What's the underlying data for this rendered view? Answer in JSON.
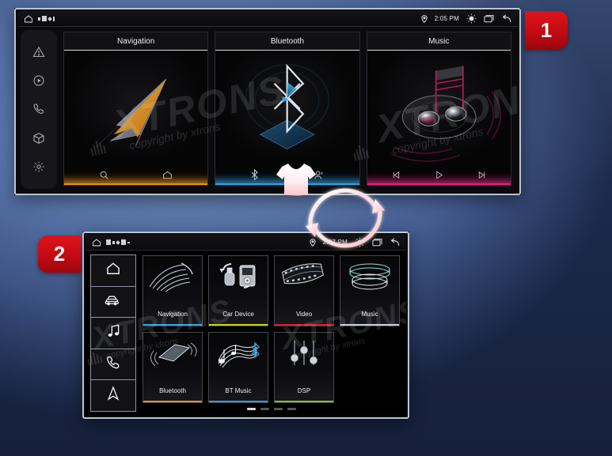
{
  "background": {
    "top_color": "#5b79ad",
    "bottom_color": "#1e2a4a"
  },
  "badges": [
    {
      "name": "step-one",
      "label": "1",
      "color": "#cc0a12"
    },
    {
      "name": "step-two",
      "label": "2",
      "color": "#cc0a12"
    }
  ],
  "swap_graphic": {
    "name": "ui-theme-swap",
    "icon": "tshirt-icon",
    "arrow_icon": "circular-arrows-icon",
    "color": "#f2b6bd"
  },
  "screen1": {
    "statusbar": {
      "home_icon": "home-icon",
      "indicator_icons": [
        "sd-card-icon",
        "battery-icon",
        "bluetooth-dot-icon",
        "gps-icon"
      ],
      "location_icon": "location-pin-icon",
      "time": "2:05 PM",
      "brightness_icon": "brightness-icon",
      "recents_icon": "recents-icon",
      "back_icon": "back-arrow-icon"
    },
    "sidebar": {
      "items": [
        {
          "name": "sidebar-item-adas",
          "icon": "warning-triangle-icon"
        },
        {
          "name": "sidebar-item-media",
          "icon": "play-circle-icon"
        },
        {
          "name": "sidebar-item-phone",
          "icon": "phone-icon"
        },
        {
          "name": "sidebar-item-apps",
          "icon": "cube-icon"
        },
        {
          "name": "sidebar-item-settings",
          "icon": "gear-icon"
        }
      ]
    },
    "cards": [
      {
        "name": "card-navigation",
        "title": "Navigation",
        "accent": "#e8901a",
        "art": "navigation-arrow-art",
        "controls": [
          {
            "name": "nav-search-button",
            "icon": "search-icon"
          },
          {
            "name": "nav-home-button",
            "icon": "home-icon"
          }
        ]
      },
      {
        "name": "card-bluetooth",
        "title": "Bluetooth",
        "accent": "#2f9fe0",
        "art": "bluetooth-logo-art",
        "controls": [
          {
            "name": "bt-toggle-button",
            "icon": "bluetooth-icon"
          },
          {
            "name": "bt-contacts-button",
            "icon": "contacts-icon"
          }
        ]
      },
      {
        "name": "card-music",
        "title": "Music",
        "accent": "#e0247c",
        "art": "music-disc-art",
        "controls": [
          {
            "name": "music-prev-button",
            "icon": "previous-track-icon"
          },
          {
            "name": "music-play-button",
            "icon": "play-icon"
          },
          {
            "name": "music-next-button",
            "icon": "next-track-icon"
          }
        ]
      }
    ]
  },
  "screen2": {
    "statusbar": {
      "home_icon": "home-icon",
      "indicator_icons": [
        "sd-card-icon",
        "sim-icon",
        "bluetooth-dot-icon",
        "battery-icon",
        "gps-icon"
      ],
      "location_icon": "location-pin-icon",
      "time": "2:07 PM",
      "brightness_icon": "brightness-icon",
      "recents_icon": "recents-icon",
      "back_icon": "back-arrow-icon"
    },
    "sidebar": {
      "items": [
        {
          "name": "sidebar-item-home",
          "icon": "home-icon"
        },
        {
          "name": "sidebar-item-car",
          "icon": "car-icon"
        },
        {
          "name": "sidebar-item-music",
          "icon": "music-note-icon"
        },
        {
          "name": "sidebar-item-phone",
          "icon": "phone-icon"
        },
        {
          "name": "sidebar-item-navigation",
          "icon": "navigation-arrow-icon"
        }
      ]
    },
    "tiles_row1": [
      {
        "name": "tile-navigation",
        "label": "Navigation",
        "accent": "#2f9fe0",
        "art": "navigation-swoosh-art"
      },
      {
        "name": "tile-car-device",
        "label": "Car Device",
        "accent": "#c8d41e",
        "art": "usb-ipod-art"
      },
      {
        "name": "tile-video",
        "label": "Video",
        "accent": "#d61f26",
        "art": "film-strip-art"
      },
      {
        "name": "tile-music",
        "label": "Music",
        "accent": "#c8ccd4",
        "art": "stacked-discs-art"
      }
    ],
    "tiles_row2": [
      {
        "name": "tile-bluetooth",
        "label": "Bluetooth",
        "accent": "#e8901a",
        "art": "phone-device-art"
      },
      {
        "name": "tile-bt-music",
        "label": "BT Music",
        "accent": "#2f9fe0",
        "art": "music-wave-art"
      },
      {
        "name": "tile-dsp",
        "label": "DSP",
        "accent": "#7bc91f",
        "art": "equalizer-sliders-art"
      }
    ],
    "pager": {
      "name": "page-indicator",
      "count": 4,
      "active": 1
    }
  },
  "watermarks": {
    "brand": "XTRONS",
    "copyright": "copyright by xtrons"
  }
}
